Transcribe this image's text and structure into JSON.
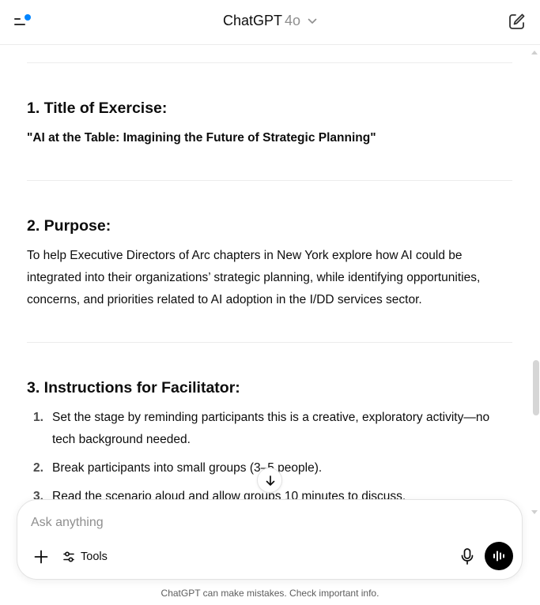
{
  "header": {
    "model_name": "ChatGPT",
    "model_version": "4o",
    "icons": [
      "sidebar-toggle-icon",
      "chevron-down-icon",
      "new-chat-icon"
    ],
    "accent_dot_color": "#0285ff"
  },
  "sections": [
    {
      "heading": "1. Title of Exercise:",
      "quote": "\"AI at the Table: Imagining the Future of Strategic Planning\""
    },
    {
      "heading": "2. Purpose:",
      "lines": [
        "To help Executive Directors of Arc chapters in New York explore how AI could be",
        "integrated into their organizations’ strategic planning, while identifying opportunities,",
        "concerns, and priorities related to AI adoption in the I/DD services sector."
      ]
    },
    {
      "heading": "3. Instructions for Facilitator:",
      "items": [
        {
          "num": "1.",
          "lines": [
            "Set the stage by reminding participants this is a creative, exploratory activity—no",
            "tech background needed."
          ]
        },
        {
          "num": "2.",
          "lines": [
            "Break participants into small groups (3–5 people)."
          ]
        },
        {
          "num": "3.",
          "lines": [
            "Read the scenario aloud and allow groups 10 minutes to discuss."
          ]
        }
      ]
    }
  ],
  "composer": {
    "placeholder": "Ask anything",
    "tools_label": "Tools",
    "icons": [
      "plus-icon",
      "tools-icon",
      "microphone-icon",
      "voice-mode-icon"
    ]
  },
  "disclaimer": "ChatGPT can make mistakes. Check important info."
}
